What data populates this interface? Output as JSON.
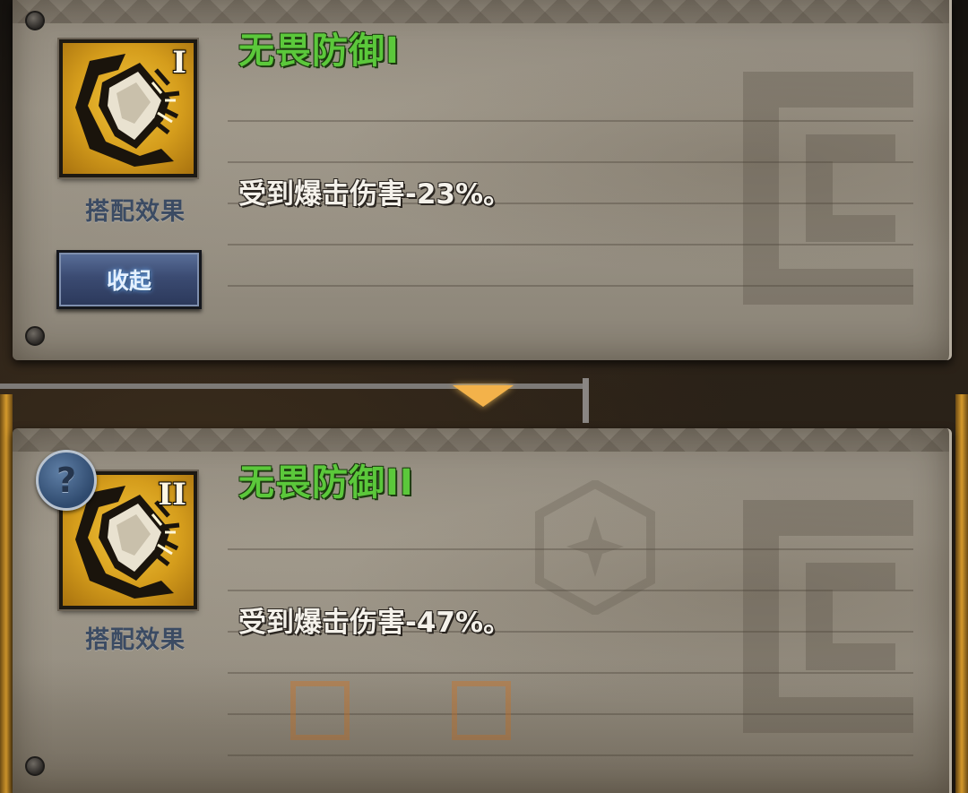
{
  "cards": [
    {
      "title": "无畏防御I",
      "roman": "I",
      "caption": "搭配效果",
      "description": "受到爆击伤害-23%。",
      "button_label": "收起",
      "icon": "cracked-shield-icon"
    },
    {
      "title": "无畏防御II",
      "roman": "II",
      "caption": "搭配效果",
      "description": "受到爆击伤害-47%。",
      "help_label": "?",
      "icon": "cracked-shield-icon"
    }
  ],
  "colors": {
    "title_green": "#5bc83b",
    "icon_gold": "#d59d1c",
    "button_blue": "#3b4b72",
    "arrow_orange": "#f3b24a"
  }
}
